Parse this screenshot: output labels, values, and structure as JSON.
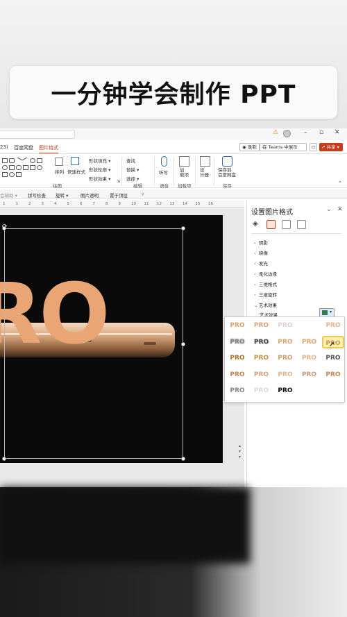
{
  "banner": {
    "title": "一分钟学会制作 PPT"
  },
  "titlebar": {
    "minimize": "–",
    "restore": "▫",
    "close": "✕"
  },
  "tabs": [
    {
      "label": "23)"
    },
    {
      "label": "百度网盘"
    },
    {
      "label": "图片格式",
      "active": true
    }
  ],
  "tab_actions": {
    "record": "◉ 录制",
    "teams": "在 Teams 中展示",
    "comment": "▭",
    "share": "↗ 共享 ▾"
  },
  "ribbon": {
    "arrange": "排列",
    "quick_styles": "快速样式",
    "shape_fill": "形状填充 ▾",
    "shape_outline": "形状轮廓 ▾",
    "shape_effects": "形状效果 ▾",
    "find": "查找",
    "replace": "替换 ▾",
    "select": "选择 ▾",
    "dictate": "听写",
    "addins": "加\n载项",
    "designer": "设\n计器",
    "save_to_baidu": "保存到\n百度网盘",
    "groups": {
      "drawing": "绘图",
      "editing": "编辑",
      "voice": "语音",
      "addins": "加载项",
      "save": "保存"
    }
  },
  "qat": {
    "item1": "会辅助 ▾",
    "spell_check": "拼写检查",
    "rotate": "旋转 ▾",
    "transparency": "图片透明",
    "bring_front": "置于顶层",
    "more": "▿"
  },
  "ruler": {
    "ticks": [
      "1",
      "1",
      "2",
      "3",
      "4",
      "5",
      "6",
      "7",
      "8",
      "9",
      "10",
      "11",
      "12",
      "13",
      "14",
      "15",
      "16"
    ]
  },
  "slide": {
    "text": "RO"
  },
  "pane": {
    "title": "设置图片格式",
    "menu_icon": "⌄",
    "close_icon": "✕",
    "sections": [
      "阴影",
      "映像",
      "发光",
      "柔化边缘",
      "三维格式",
      "三维旋转",
      "艺术效果"
    ],
    "art_effect_label": "艺术效果"
  },
  "gallery": {
    "cells": [
      [
        "PRO",
        "PRO",
        "PRO",
        "",
        "PRO"
      ],
      [
        "PRO",
        "PRO",
        "PRO",
        "PRO",
        "PRO"
      ],
      [
        "PRO",
        "PRO",
        "PRO",
        "PRO",
        "PRO"
      ],
      [
        "PRO",
        "PRO",
        "PRO",
        "PRO",
        "PRO"
      ],
      [
        "PRO",
        "PRO",
        "PRO",
        "",
        ""
      ]
    ],
    "colors": [
      [
        "#e3a36f",
        "#d9a27a",
        "#ddd3cc",
        "#ffffff",
        "#e3b48f"
      ],
      [
        "#8a8a8a",
        "#444444",
        "#e3a36f",
        "#e6a06c",
        "#d98e55"
      ],
      [
        "#b0702c",
        "#c7903d",
        "#d69b64",
        "#e4b48a",
        "#555555"
      ],
      [
        "#c98554",
        "#d6a37c",
        "#e2b792",
        "#c79c77",
        "#c88a58"
      ],
      [
        "#888888",
        "#d9d9d9",
        "#111111",
        "#ffffff",
        "#ffffff"
      ]
    ]
  },
  "colors": {
    "accent": "#c43e1c",
    "slide_bg": "#0a0a0a",
    "pro_orange": "#e9a574"
  }
}
